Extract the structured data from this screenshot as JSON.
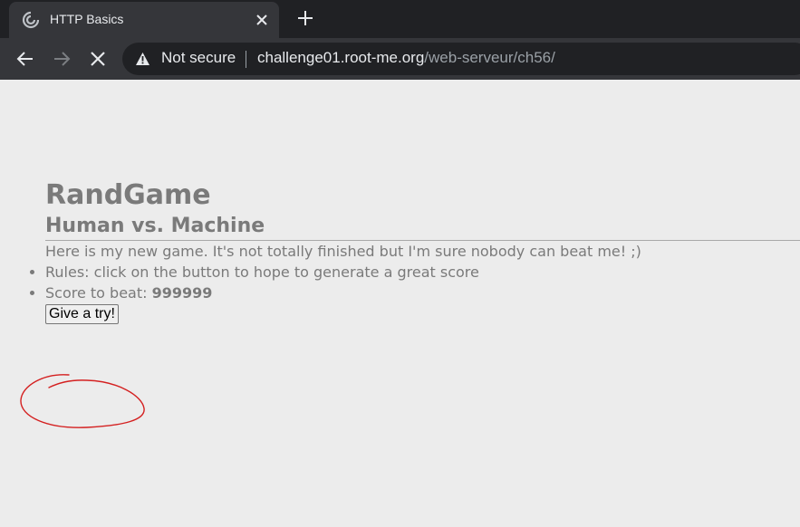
{
  "browser": {
    "tab": {
      "title": "HTTP Basics"
    },
    "address_bar": {
      "security_label": "Not secure",
      "url_host": "challenge01.root-me.org",
      "url_path": "/web-serveur/ch56/"
    }
  },
  "page": {
    "title": "RandGame",
    "subtitle": "Human vs. Machine",
    "intro": "Here is my new game. It's not totally finished but I'm sure nobody can beat me! ;)",
    "rules_text": "Rules: click on the button to hope to generate a great score",
    "score_label": "Score to beat: ",
    "score_value": "999999",
    "button_label": "Give a try!"
  },
  "colors": {
    "page_background": "#ececec",
    "page_text": "#7a7a7a",
    "annotation_red": "#d42020",
    "chrome_dark": "#202124",
    "chrome_tab": "#35363a"
  },
  "icons": {
    "tab_favicon": "loading-spinner-icon",
    "tab_close": "close-icon",
    "new_tab": "plus-icon",
    "back": "arrow-left-icon",
    "forward": "arrow-right-icon",
    "stop": "stop-icon",
    "security": "warning-triangle-icon"
  }
}
